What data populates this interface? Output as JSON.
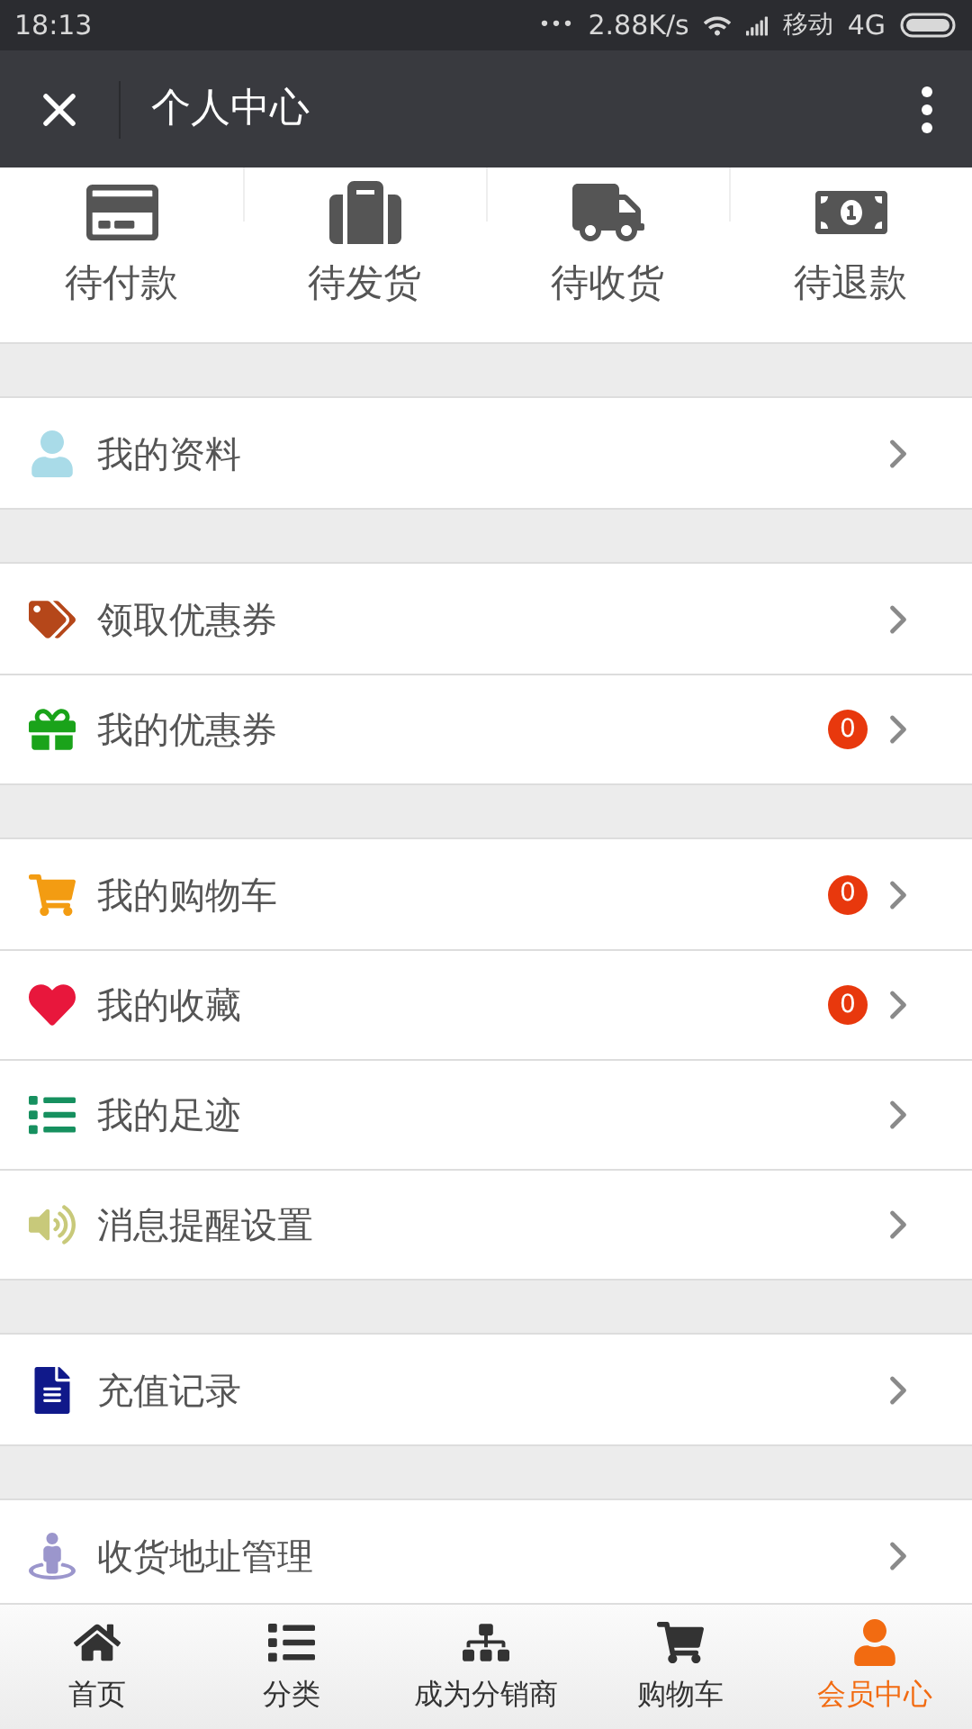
{
  "status_bar": {
    "time": "18:13",
    "dots": "•••",
    "speed": "2.88K/s",
    "carrier": "移动",
    "network": "4G"
  },
  "header": {
    "title": "个人中心"
  },
  "orders": [
    {
      "kind": "card",
      "label": "待付款"
    },
    {
      "kind": "suitcase",
      "label": "待发货"
    },
    {
      "kind": "truck",
      "label": "待收货"
    },
    {
      "kind": "money",
      "label": "待退款"
    }
  ],
  "groups": [
    {
      "items": [
        {
          "kind": "user",
          "label": "我的资料"
        }
      ]
    },
    {
      "items": [
        {
          "kind": "tags",
          "label": "领取优惠券"
        },
        {
          "kind": "gift",
          "label": "我的优惠券",
          "badge": "0"
        }
      ]
    },
    {
      "items": [
        {
          "kind": "cart",
          "label": "我的购物车",
          "badge": "0"
        },
        {
          "kind": "heart",
          "label": "我的收藏",
          "badge": "0"
        },
        {
          "kind": "list",
          "label": "我的足迹"
        },
        {
          "kind": "speaker",
          "label": "消息提醒设置"
        }
      ]
    },
    {
      "items": [
        {
          "kind": "file",
          "label": "充值记录"
        }
      ]
    },
    {
      "items": [
        {
          "kind": "location",
          "label": "收货地址管理"
        }
      ]
    }
  ],
  "tab_bar": [
    {
      "kind": "home",
      "label": "首页",
      "selected": false
    },
    {
      "kind": "list",
      "label": "分类",
      "selected": false
    },
    {
      "kind": "sitemap",
      "label": "成为分销商",
      "selected": false
    },
    {
      "kind": "cart",
      "label": "购物车",
      "selected": false
    },
    {
      "kind": "user",
      "label": "会员中心",
      "selected": true
    }
  ]
}
